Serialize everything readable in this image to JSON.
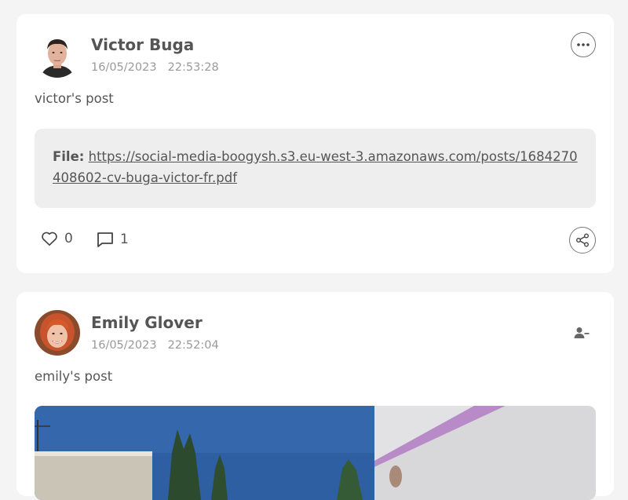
{
  "posts": [
    {
      "author": "Victor Buga",
      "date": "16/05/2023",
      "time": "22:53:28",
      "text": "victor's post",
      "file_label": "File:",
      "file_url": "https://social-media-boogysh.s3.eu-west-3.amazonaws.com/posts/1684270408602-cv-buga-victor-fr.pdf",
      "likes": "0",
      "comments": "1",
      "icons": {
        "menu": "more-horizontal-icon",
        "like": "heart-icon",
        "comment": "comment-icon",
        "share": "share-icon"
      }
    },
    {
      "author": "Emily Glover",
      "date": "16/05/2023",
      "time": "22:52:04",
      "text": "emily's post",
      "icons": {
        "unfollow": "user-minus-icon"
      }
    }
  ],
  "colors": {
    "background": "#f4f4f4",
    "card": "#ffffff",
    "file_box": "#eeeeee",
    "text": "#555555",
    "meta": "#999999"
  }
}
